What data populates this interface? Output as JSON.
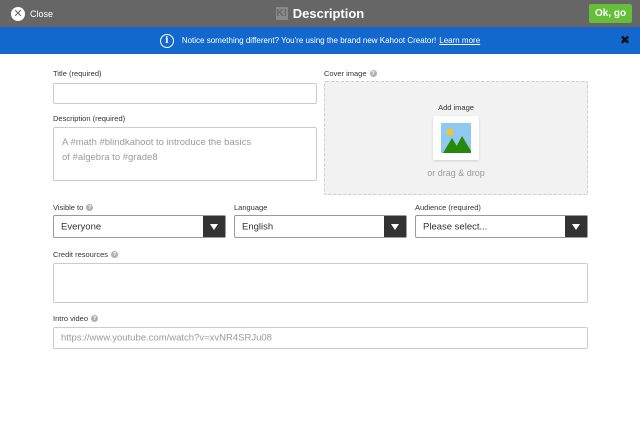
{
  "topbar": {
    "close_label": "Close",
    "close_icon": "close-icon",
    "logo_text": "K!",
    "title": "Description",
    "ok_label": "Ok, go",
    "ok_color": "#66bf39",
    "bar_color": "#666666"
  },
  "banner": {
    "text": "Notice something different? You're using the brand new Kahoot Creator!",
    "link": "Learn more",
    "info_glyph": "i",
    "close_glyph": "✖",
    "color": "#1368ce"
  },
  "form": {
    "title_label": "Title (required)",
    "title_value": "",
    "description_label": "Description (required)",
    "description_placeholder_line1": "A #math #blindkahoot to introduce the basics",
    "description_placeholder_line2": "of #algebra to #grade8",
    "cover_label": "Cover image",
    "add_image_label": "Add image",
    "drag_drop_label": "or drag & drop",
    "visible_label": "Visible to",
    "visible_value": "Everyone",
    "language_label": "Language",
    "language_value": "English",
    "audience_label": "Audience (required)",
    "audience_value": "Please select...",
    "credit_label": "Credit resources",
    "credit_value": "",
    "intro_label": "Intro video",
    "intro_placeholder": "https://www.youtube.com/watch?v=xvNR4SRJu08",
    "help_glyph": "?"
  }
}
